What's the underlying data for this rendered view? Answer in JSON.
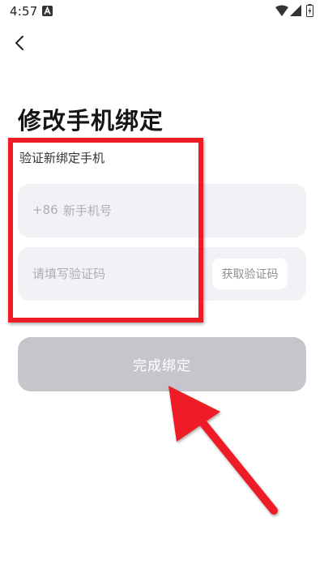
{
  "status_bar": {
    "time": "4:57",
    "app_icon": "a-letter-icon",
    "wifi_icon": "wifi-icon",
    "signal_icon": "signal-icon",
    "battery_icon": "battery-charging-icon"
  },
  "nav": {
    "back_icon": "chevron-left-icon"
  },
  "page": {
    "title": "修改手机绑定",
    "section_label": "验证新绑定手机"
  },
  "phone_field": {
    "country_code": "+86",
    "value": "",
    "placeholder": "新手机号"
  },
  "code_field": {
    "value": "",
    "placeholder": "请填写验证码",
    "get_code_label": "获取验证码"
  },
  "submit": {
    "label": "完成绑定"
  },
  "colors": {
    "field_background": "#f2f2f6",
    "submit_background": "#c6c5cc",
    "annotation_red": "#ee1c25"
  }
}
